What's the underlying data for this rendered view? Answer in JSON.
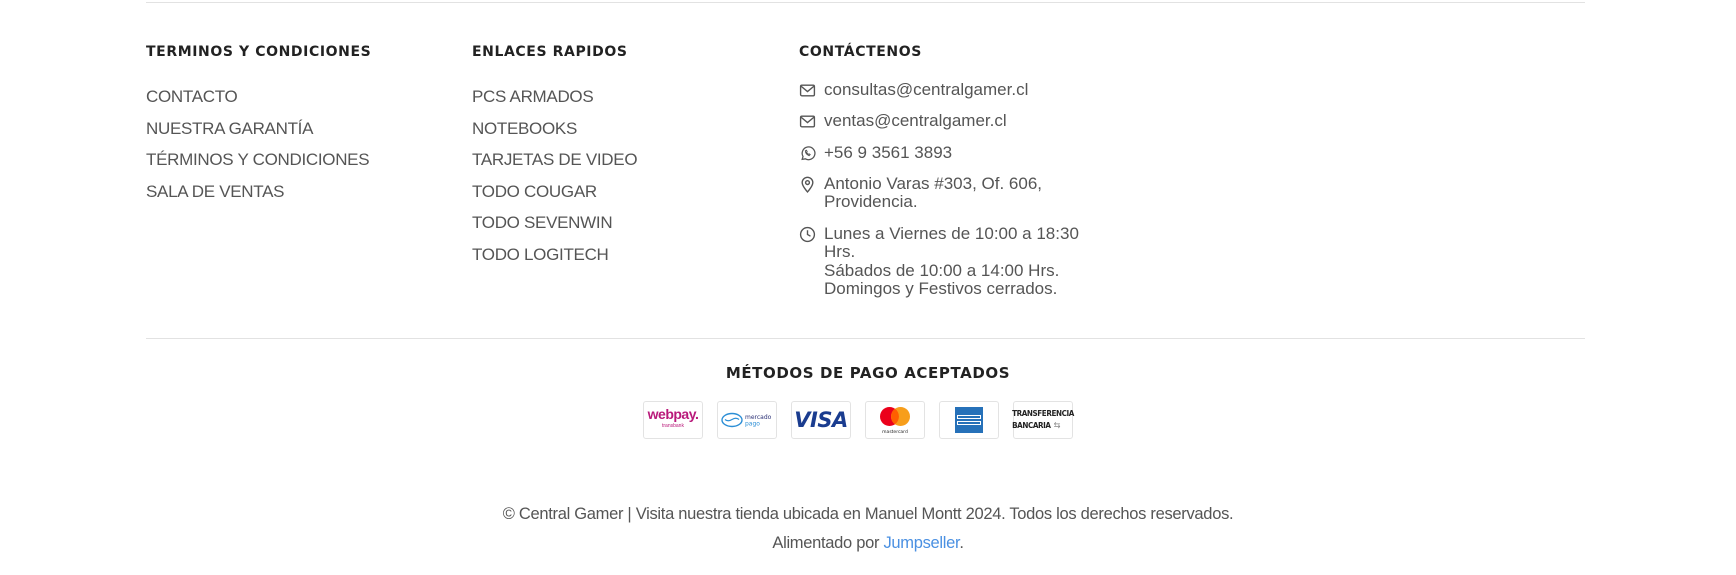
{
  "columns": {
    "terms": {
      "title": "TERMINOS Y CONDICIONES",
      "links": [
        "CONTACTO",
        "NUESTRA GARANTÍA",
        "TÉRMINOS Y CONDICIONES",
        "SALA DE VENTAS"
      ]
    },
    "quick": {
      "title": "ENLACES RAPIDOS",
      "links": [
        "PCS ARMADOS",
        "NOTEBOOKS",
        "TARJETAS DE VIDEO",
        "TODO COUGAR",
        "TODO SEVENWIN",
        "TODO LOGITECH"
      ]
    },
    "contact": {
      "title": "CONTÁCTENOS",
      "email1": "consultas@centralgamer.cl",
      "email2": "ventas@centralgamer.cl",
      "phone": "+56 9 3561 3893",
      "address": "Antonio Varas #303, Of. 606,\nProvidencia.",
      "hours": "Lunes a Viernes de 10:00 a 18:30\nHrs.\nSábados de 10:00 a 14:00 Hrs.\nDomingos y Festivos cerrados."
    }
  },
  "payments": {
    "title": "MÉTODOS DE PAGO ACEPTADOS",
    "webpay_label": "webpay.",
    "webpay_sub": "transbank",
    "mercadopago_label": "mercado pago",
    "visa_label": "VISA",
    "mastercard_label": "mastercard",
    "amex_label": "AMERICAN EXPRESS",
    "transfer_line1": "TRANSFERENCIA",
    "transfer_line2": "BANCARIA"
  },
  "footer": {
    "copyright_symbol": "©",
    "copyright": "Central Gamer | Visita nuestra tienda ubicada en Manuel Montt 2024. Todos los derechos reservados.",
    "powered_prefix": "Alimentado por",
    "powered_link": "Jumpseller",
    "powered_suffix": "."
  },
  "colors": {
    "heading": "#222222",
    "text": "#555555",
    "link": "#4a90e2",
    "divider": "#e2e2e2",
    "webpay": "#b9197a",
    "visa": "#1a3c8f",
    "amex": "#2671b9"
  }
}
